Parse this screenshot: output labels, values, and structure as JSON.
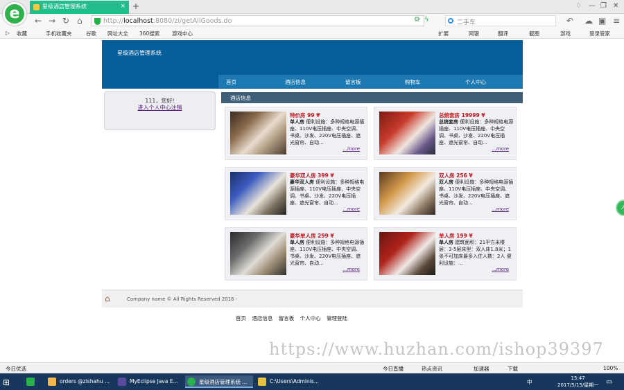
{
  "browser": {
    "tab_title": "星级酒店管理系统",
    "tab_close": "×",
    "new_tab": "+",
    "address": {
      "scheme": "http://",
      "host": "localhost",
      "path": ":8080/zi/getAllGoods.do"
    },
    "search_placeholder": "二手车",
    "bookmarks": [
      "收藏",
      "手机收藏夹",
      "谷歌",
      "网址大全",
      "360搜索",
      "游戏中心"
    ],
    "right_tools": [
      "扩展",
      "网银",
      "翻译",
      "截图",
      "游戏",
      "登录管家"
    ]
  },
  "site": {
    "title": "星级酒店管理系统",
    "nav": [
      "首页",
      "酒店信息",
      "留言板",
      "购物车",
      "个人中心"
    ],
    "sidebar": {
      "greeting": "111，您好!",
      "link_text": "进入个人中心注销"
    },
    "section_title": "酒店信息",
    "rooms": [
      {
        "title": "特价房 99 ¥",
        "name": "单人房",
        "desc": "便利设施：多种规格电源插座、110V电压插座、中央空调、书桌、沙发、220V电压插座、遮光窗帘、自动...",
        "more": "...more"
      },
      {
        "title": "总统套房 19999 ¥",
        "name": "总统套房",
        "desc": "便利设施：多种规格电源插座、110V电压插座、中央空调、书桌、沙发、220V电压插座、遮光窗帘、自动...",
        "more": "...more"
      },
      {
        "title": "豪华双人房 399 ¥",
        "name": "豪华双人房",
        "desc": "便利设施：多种规格电源插座、110V电压插座、中央空调、书桌、沙发、220V电压插座、遮光窗帘、自动...",
        "more": "...more"
      },
      {
        "title": "双人房 256 ¥",
        "name": "双人房",
        "desc": "便利设施：多种规格电源插座、110V电压插座、中央空调、书桌、沙发、220V电压插座、遮光窗帘、自动...",
        "more": "...more"
      },
      {
        "title": "豪华单人房 299 ¥",
        "name": "单人房",
        "desc": "便利设施：多种规格电源插座、110V电压插座、中央空调、书桌、沙发、220V电压插座、遮光窗帘、自动...",
        "more": "...more"
      },
      {
        "title": "单人房 199 ¥",
        "name": "单人房",
        "desc": "建筑面积：21平方米楼层：3-5层床型：双人床1.8米；1张不可加床最多入住人数：2人 便利设施：...",
        "more": "...more"
      }
    ],
    "footer_copy": "Company name © All Rights Reserved 2016 -",
    "footer_links": [
      "首页",
      "酒店信息",
      "留言板",
      "个人中心",
      "管理登陆"
    ]
  },
  "watermark": "https://www.huzhan.com/ishop39397",
  "statusbar": {
    "left": "今日优选",
    "items": [
      "今日直播",
      "热点资讯",
      "加速器",
      "下载"
    ],
    "zoom": "100%"
  },
  "taskbar": {
    "items": [
      "orders @zishahu ...",
      "MyEclipse Java E...",
      "星级酒店管理系统 ...",
      "C:\\Users\\Adminis..."
    ],
    "time": "15:47",
    "date": "2017/5/15/星期一",
    "ime": "中"
  }
}
